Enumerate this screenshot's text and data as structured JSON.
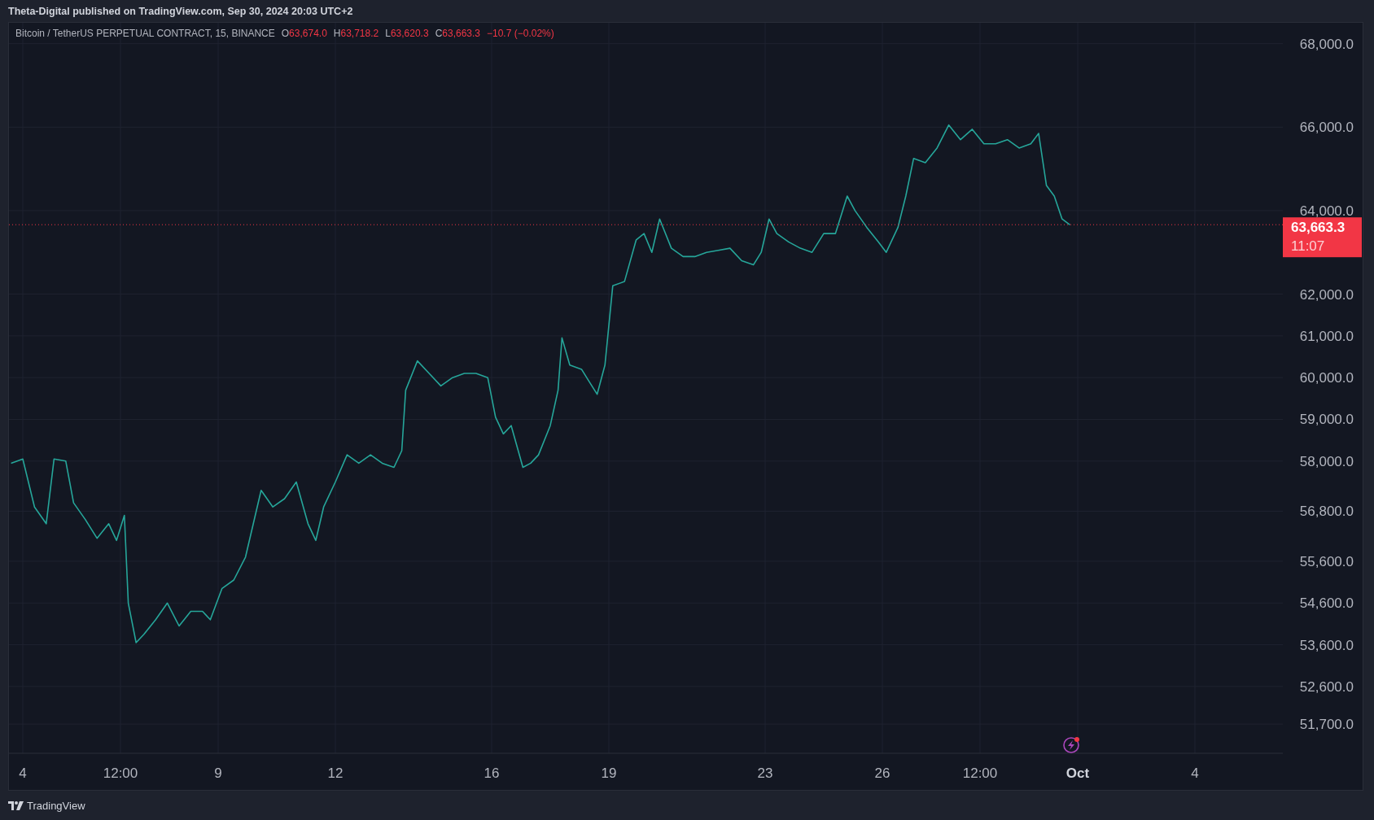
{
  "header": {
    "text": "Theta-Digital published on TradingView.com, Sep 30, 2024 20:03 UTC+2"
  },
  "legend": {
    "symbol": "Bitcoin / TetherUS PERPETUAL CONTRACT, 15, BINANCE",
    "ohlc": [
      {
        "key": "O",
        "value": "63,674.0"
      },
      {
        "key": "H",
        "value": "63,718.2"
      },
      {
        "key": "L",
        "value": "63,620.3"
      },
      {
        "key": "C",
        "value": "63,663.3"
      }
    ],
    "change": "−10.7 (−0.02%)"
  },
  "last_price": {
    "countdown": "11:07"
  },
  "chart_data": {
    "type": "line",
    "x": [
      "2024-09-03 16:48",
      "2024-09-04 00:00",
      "2024-09-04 07:12",
      "2024-09-04 14:24",
      "2024-09-04 19:12",
      "2024-09-05 02:24",
      "2024-09-05 07:12",
      "2024-09-05 14:24",
      "2024-09-05 21:36",
      "2024-09-06 04:48",
      "2024-09-06 09:36",
      "2024-09-06 14:24",
      "2024-09-06 16:48",
      "2024-09-06 21:36",
      "2024-09-07 02:24",
      "2024-09-07 09:36",
      "2024-09-07 16:48",
      "2024-09-08 00:00",
      "2024-09-08 07:12",
      "2024-09-08 14:24",
      "2024-09-08 19:12",
      "2024-09-09 02:24",
      "2024-09-09 09:36",
      "2024-09-09 16:48",
      "2024-09-09 21:36",
      "2024-09-10 02:24",
      "2024-09-10 09:36",
      "2024-09-10 16:48",
      "2024-09-11 00:00",
      "2024-09-11 07:12",
      "2024-09-11 12:00",
      "2024-09-11 16:48",
      "2024-09-12 00:00",
      "2024-09-12 07:12",
      "2024-09-12 14:24",
      "2024-09-12 21:36",
      "2024-09-13 04:48",
      "2024-09-13 12:00",
      "2024-09-13 16:48",
      "2024-09-13 19:12",
      "2024-09-14 02:24",
      "2024-09-14 09:36",
      "2024-09-14 16:48",
      "2024-09-15 00:00",
      "2024-09-15 07:12",
      "2024-09-15 14:24",
      "2024-09-15 21:36",
      "2024-09-16 02:24",
      "2024-09-16 07:12",
      "2024-09-16 12:00",
      "2024-09-16 19:12",
      "2024-09-17 00:00",
      "2024-09-17 04:48",
      "2024-09-17 12:00",
      "2024-09-17 16:48",
      "2024-09-17 19:12",
      "2024-09-18 00:00",
      "2024-09-18 07:12",
      "2024-09-18 12:00",
      "2024-09-18 16:48",
      "2024-09-18 21:36",
      "2024-09-19 02:24",
      "2024-09-19 09:36",
      "2024-09-19 16:48",
      "2024-09-19 21:36",
      "2024-09-20 02:24",
      "2024-09-20 07:12",
      "2024-09-20 14:24",
      "2024-09-20 21:36",
      "2024-09-21 04:48",
      "2024-09-21 12:00",
      "2024-09-21 19:12",
      "2024-09-22 02:24",
      "2024-09-22 09:36",
      "2024-09-22 16:48",
      "2024-09-22 21:36",
      "2024-09-23 02:24",
      "2024-09-23 07:12",
      "2024-09-23 14:24",
      "2024-09-23 21:36",
      "2024-09-24 04:48",
      "2024-09-24 12:00",
      "2024-09-24 19:12",
      "2024-09-25 02:24",
      "2024-09-25 07:12",
      "2024-09-25 14:24",
      "2024-09-25 21:36",
      "2024-09-26 02:24",
      "2024-09-26 09:36",
      "2024-09-26 14:24",
      "2024-09-26 19:12",
      "2024-09-27 02:24",
      "2024-09-27 09:36",
      "2024-09-27 16:48",
      "2024-09-28 00:00",
      "2024-09-28 07:12",
      "2024-09-28 14:24",
      "2024-09-28 21:36",
      "2024-09-29 04:48",
      "2024-09-29 12:00",
      "2024-09-29 19:12",
      "2024-09-30 00:00",
      "2024-09-30 04:48",
      "2024-09-30 09:36",
      "2024-09-30 14:24",
      "2024-09-30 19:12"
    ],
    "values": [
      57950,
      58050,
      56900,
      56500,
      58050,
      58000,
      57000,
      56600,
      56150,
      56500,
      56100,
      56700,
      54600,
      53650,
      53850,
      54200,
      54600,
      54050,
      54400,
      54400,
      54200,
      54950,
      55150,
      55700,
      56500,
      57300,
      56900,
      57100,
      57500,
      56500,
      56100,
      56900,
      57500,
      58150,
      57950,
      58150,
      57950,
      57850,
      58250,
      59700,
      60400,
      60100,
      59800,
      60000,
      60100,
      60100,
      60000,
      59050,
      58650,
      58850,
      57850,
      57950,
      58150,
      58850,
      59700,
      60950,
      60300,
      60200,
      59900,
      59600,
      60300,
      62200,
      62300,
      63300,
      63450,
      63000,
      63800,
      63100,
      62900,
      62900,
      63000,
      63050,
      63100,
      62800,
      62700,
      63000,
      63800,
      63450,
      63250,
      63100,
      63000,
      63450,
      63450,
      64350,
      64000,
      63600,
      63250,
      63000,
      63600,
      64350,
      65250,
      65150,
      65500,
      66050,
      65700,
      65950,
      65600,
      65600,
      65700,
      65500,
      65600,
      65850,
      64600,
      64350,
      63800,
      63660
    ],
    "xlim": [
      "2024-09-03 15:30",
      "2024-10-06 06:00"
    ],
    "ylim": [
      51000,
      68500
    ],
    "grid": true,
    "ref_lines": [
      {
        "axis": "y",
        "value": 63663.3,
        "label": "63,663.3",
        "color": "#f23645"
      }
    ],
    "xticks": [
      {
        "value": "2024-09-04 00:00",
        "label": "4"
      },
      {
        "value": "2024-09-06 12:00",
        "label": "12:00"
      },
      {
        "value": "2024-09-09 00:00",
        "label": "9"
      },
      {
        "value": "2024-09-12 00:00",
        "label": "12"
      },
      {
        "value": "2024-09-16 00:00",
        "label": "16"
      },
      {
        "value": "2024-09-19 00:00",
        "label": "19"
      },
      {
        "value": "2024-09-23 00:00",
        "label": "23"
      },
      {
        "value": "2024-09-26 00:00",
        "label": "26"
      },
      {
        "value": "2024-09-28 12:00",
        "label": "12:00"
      },
      {
        "value": "2024-10-01 00:00",
        "label": "Oct"
      },
      {
        "value": "2024-10-04 00:00",
        "label": "4"
      }
    ],
    "yticks": [
      {
        "value": 68000,
        "label": "68,000.0"
      },
      {
        "value": 66000,
        "label": "66,000.0"
      },
      {
        "value": 64000,
        "label": "64,000.0"
      },
      {
        "value": 62000,
        "label": "62,000.0"
      },
      {
        "value": 61000,
        "label": "61,000.0"
      },
      {
        "value": 60000,
        "label": "60,000.0"
      },
      {
        "value": 59000,
        "label": "59,000.0"
      },
      {
        "value": 58000,
        "label": "58,000.0"
      },
      {
        "value": 56800,
        "label": "56,800.0"
      },
      {
        "value": 55600,
        "label": "55,600.0"
      },
      {
        "value": 54600,
        "label": "54,600.0"
      },
      {
        "value": 53600,
        "label": "53,600.0"
      },
      {
        "value": 52600,
        "label": "52,600.0"
      },
      {
        "value": 51700,
        "label": "51,700.0"
      }
    ]
  },
  "footer": {
    "brand": "TradingView"
  }
}
